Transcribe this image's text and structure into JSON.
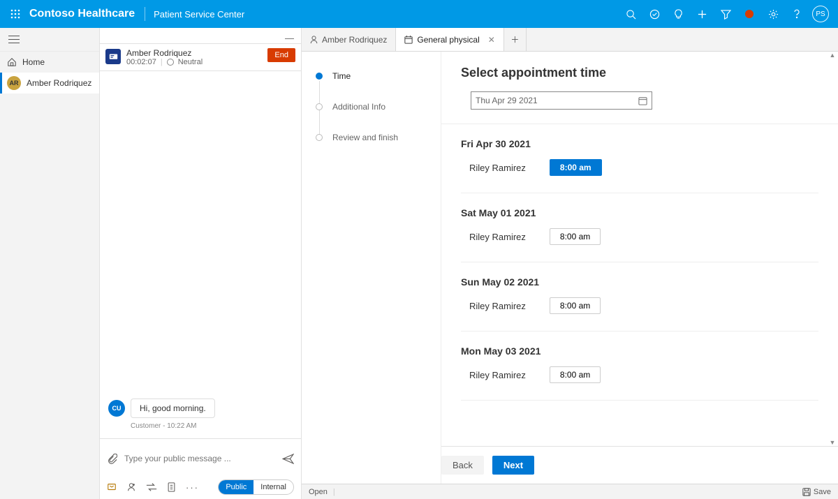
{
  "header": {
    "brand": "Contoso Healthcare",
    "subtitle": "Patient Service Center",
    "user_initials": "PS"
  },
  "left_nav": {
    "home_label": "Home",
    "patient_label": "Amber Rodriquez",
    "patient_initials": "AR"
  },
  "session": {
    "name": "Amber Rodriquez",
    "duration": "00:02:07",
    "sentiment_label": "Neutral",
    "end_label": "End"
  },
  "chat": {
    "avatar_initials": "CU",
    "message_text": "Hi, good morning.",
    "message_meta": "Customer - 10:22 AM",
    "compose_placeholder": "Type your public message ...",
    "public_label": "Public",
    "internal_label": "Internal"
  },
  "tabs": {
    "tab1_label": "Amber Rodriquez",
    "tab2_label": "General physical"
  },
  "steps": {
    "step1": "Time",
    "step2": "Additional Info",
    "step3": "Review and finish"
  },
  "appointment": {
    "title": "Select appointment time",
    "picker_value": "Thu Apr 29 2021",
    "days": [
      {
        "label": "Fri Apr 30 2021",
        "provider": "Riley Ramirez",
        "time": "8:00 am",
        "selected": true
      },
      {
        "label": "Sat May 01 2021",
        "provider": "Riley Ramirez",
        "time": "8:00 am",
        "selected": false
      },
      {
        "label": "Sun May 02 2021",
        "provider": "Riley Ramirez",
        "time": "8:00 am",
        "selected": false
      },
      {
        "label": "Mon May 03 2021",
        "provider": "Riley Ramirez",
        "time": "8:00 am",
        "selected": false
      }
    ],
    "back_label": "Back",
    "next_label": "Next"
  },
  "footer": {
    "open_label": "Open",
    "save_label": "Save"
  }
}
